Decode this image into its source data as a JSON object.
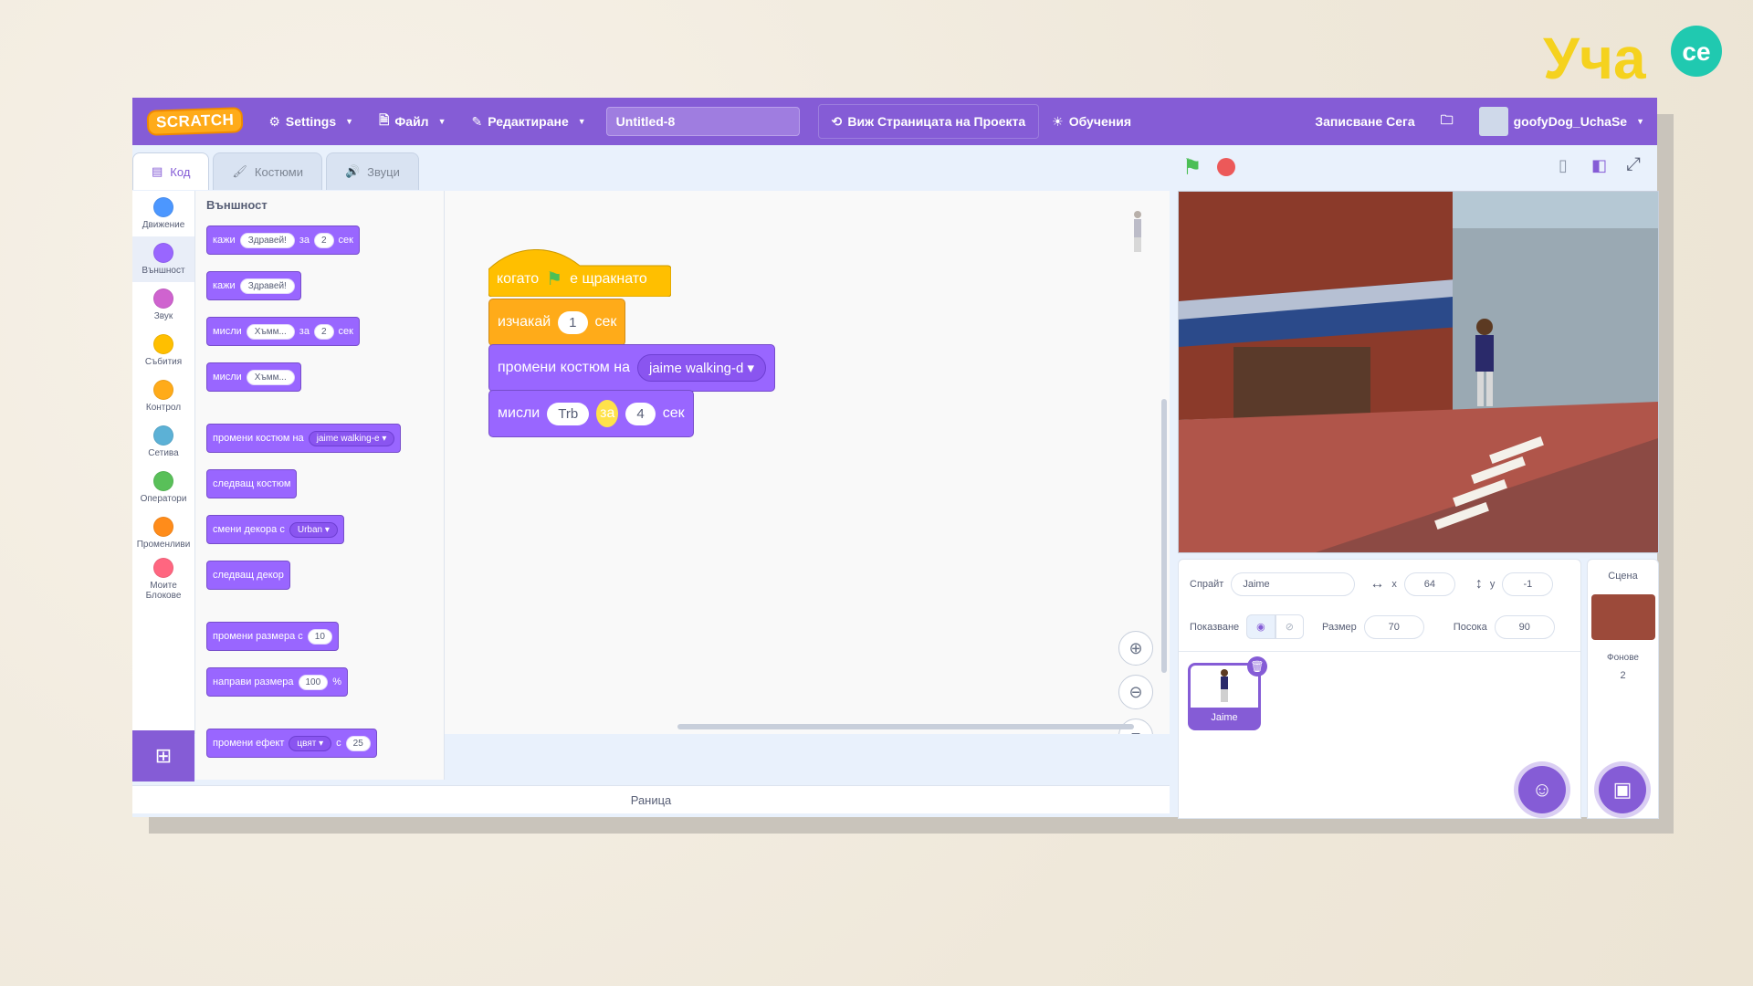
{
  "brand": {
    "text": "Уча",
    "badge": "се"
  },
  "menubar": {
    "logo": "SCRATCH",
    "settings": "Settings",
    "file": "Файл",
    "edit": "Редактиране",
    "project_title": "Untitled-8",
    "see_project": "Виж Страницата на Проекта",
    "tutorials": "Обучения",
    "save_now": "Записване Сега",
    "username": "goofyDog_UchaSe"
  },
  "tabs": {
    "code": "Код",
    "costumes": "Костюми",
    "sounds": "Звуци"
  },
  "categories": [
    {
      "label": "Движение",
      "color": "#4c97ff"
    },
    {
      "label": "Външност",
      "color": "#9966ff"
    },
    {
      "label": "Звук",
      "color": "#cf63cf"
    },
    {
      "label": "Събития",
      "color": "#ffbf00"
    },
    {
      "label": "Контрол",
      "color": "#ffab19"
    },
    {
      "label": "Сетива",
      "color": "#5cb1d6"
    },
    {
      "label": "Оператори",
      "color": "#59c059"
    },
    {
      "label": "Променливи",
      "color": "#ff8c1a"
    },
    {
      "label": "Моите Блокове",
      "color": "#ff6680"
    }
  ],
  "palette": {
    "title": "Външност",
    "say_for": {
      "say": "кажи",
      "text": "Здравей!",
      "for": "за",
      "secs": "2",
      "unit": "сек"
    },
    "say": {
      "say": "кажи",
      "text": "Здравей!"
    },
    "think_for": {
      "think": "мисли",
      "text": "Хъмм...",
      "for": "за",
      "secs": "2",
      "unit": "сек"
    },
    "think": {
      "think": "мисли",
      "text": "Хъмм..."
    },
    "switch_costume": {
      "label": "промени костюм на",
      "value": "jaime walking-e"
    },
    "next_costume": "следващ костюм",
    "switch_backdrop": {
      "label": "смени декора с",
      "value": "Urban"
    },
    "next_backdrop": "следващ декор",
    "change_size": {
      "label": "промени размера с",
      "value": "10"
    },
    "set_size": {
      "label": "направи размера",
      "value": "100",
      "unit": "%"
    },
    "change_effect": {
      "label": "промени ефект",
      "effect": "цвят",
      "by": "с",
      "value": "25"
    }
  },
  "script": {
    "hat": {
      "when": "когато",
      "clicked": "е щракнато"
    },
    "wait": {
      "label": "изчакай",
      "value": "1",
      "unit": "сек"
    },
    "switch_costume": {
      "label": "промени костюм на",
      "value": "jaime walking-d"
    },
    "think_for": {
      "think": "мисли",
      "text": "Trb",
      "for": "за",
      "secs": "4",
      "unit": "сек"
    }
  },
  "backpack": "Раница",
  "sprite_info": {
    "sprite_label": "Спрайт",
    "sprite_name": "Jaime",
    "x_label": "x",
    "x_value": "64",
    "y_label": "y",
    "y_value": "-1",
    "show_label": "Показване",
    "size_label": "Размер",
    "size_value": "70",
    "direction_label": "Посока",
    "direction_value": "90"
  },
  "sprite_thumb": "Jaime",
  "scene": {
    "title": "Сцена",
    "backdrops_label": "Фонове",
    "backdrops_count": "2"
  }
}
